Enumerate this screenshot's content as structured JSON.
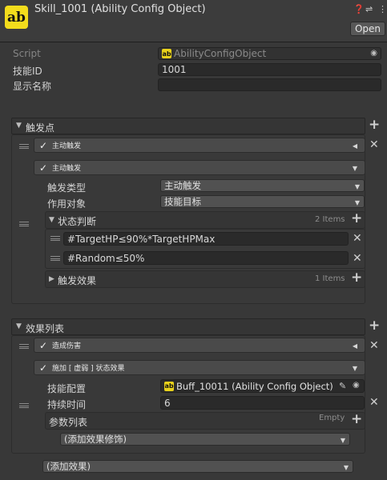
{
  "header": {
    "title": "Skill_1001 (Ability Config Object)",
    "logo_text": "ab",
    "open_label": "Open",
    "icons": [
      "help-icon",
      "presets-icon",
      "more-icon"
    ]
  },
  "fields": {
    "script_label": "Script",
    "script_value": "AbilityConfigObject",
    "skill_id_label": "技能ID",
    "skill_id_value": "1001",
    "display_name_label": "显示名称",
    "display_name_value": ""
  },
  "triggers": {
    "title": "触发点",
    "item1_title": "主动触发",
    "item2_title": "主动触发",
    "trigger_type_label": "触发类型",
    "trigger_type_value": "主动触发",
    "target_label": "作用对象",
    "target_value": "技能目标",
    "state_check": {
      "title": "状态判断",
      "count": "2 Items",
      "items": [
        "#TargetHP≤90%*TargetHPMax",
        "#Random≤50%"
      ]
    },
    "trigger_effects": {
      "title": "触发效果",
      "count": "1 Items"
    }
  },
  "effects": {
    "title": "效果列表",
    "item1_title": "造成伤害",
    "item2_title": "施加 [ 虚弱 ] 状态效果",
    "skill_config_label": "技能配置",
    "skill_config_value": "Buff_10011 (Ability Config Object)",
    "duration_label": "持续时间",
    "duration_value": "6",
    "params": {
      "title": "参数列表",
      "count": "Empty"
    },
    "add_modifier_label": "(添加效果修饰)",
    "add_effect_label": "(添加效果)"
  },
  "colors": {
    "background": "#383838",
    "logo": "#f3dc1c",
    "field": "#2a2a2a",
    "dropdown": "#515151"
  }
}
